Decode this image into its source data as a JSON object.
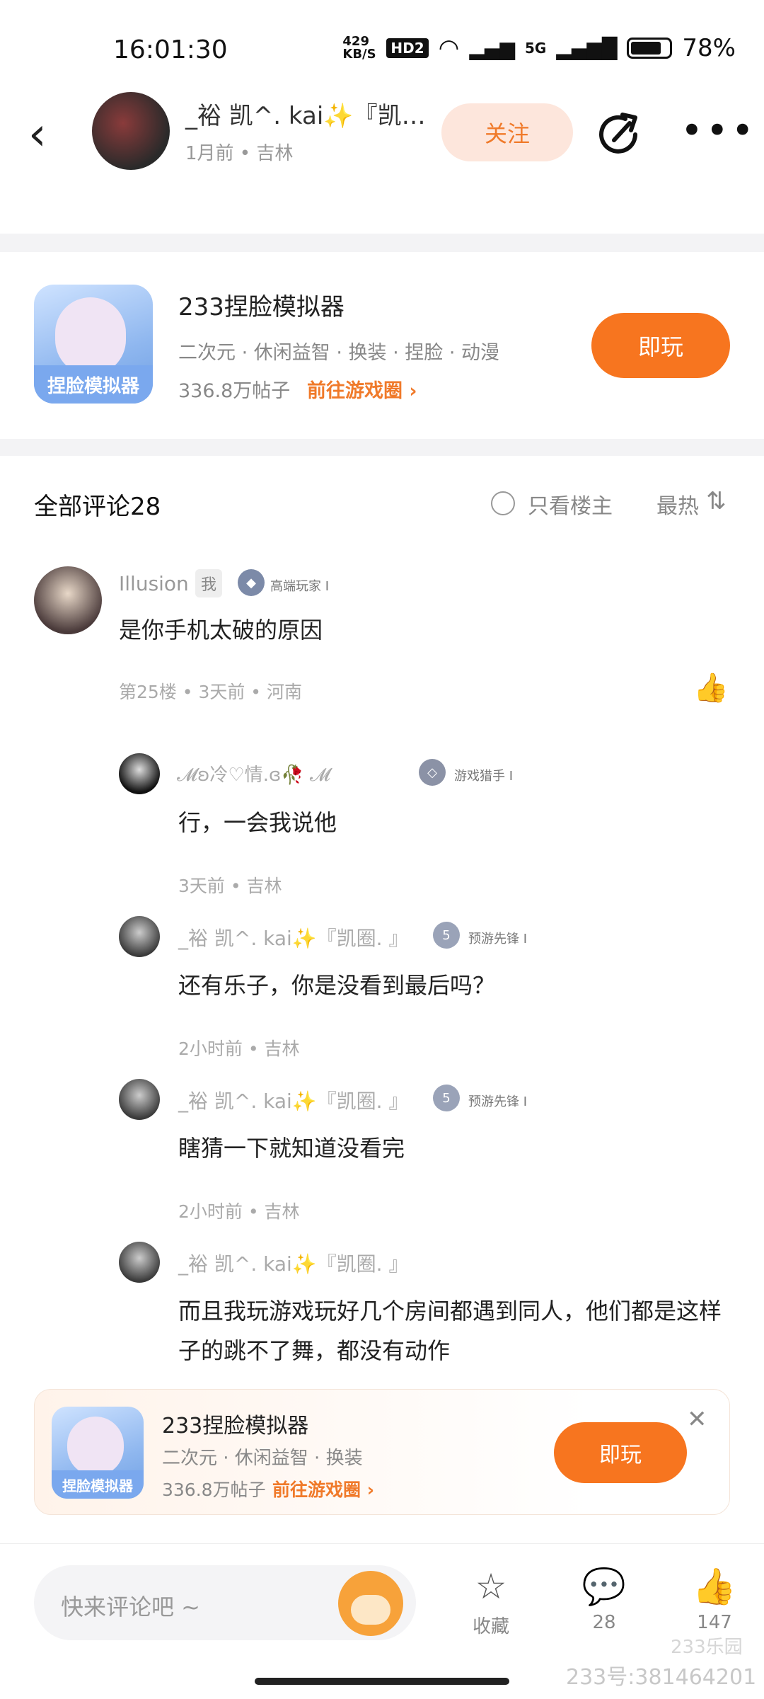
{
  "status_bar": {
    "time": "16:01:30",
    "net_speed": "429 KB/S",
    "hd": "HD2",
    "signal": "5G",
    "battery": "78%"
  },
  "header": {
    "author_name": "_裕 凯^. kai✨『凯…",
    "author_meta": "1月前 • 吉林",
    "follow_label": "关注"
  },
  "game_card": {
    "title": "233捏脸模拟器",
    "tags": "二次元 · 休闲益智 · 换装 · 捏脸 · 动漫",
    "posts": "336.8万帖子",
    "link_label": "前往游戏圈",
    "play_label": "即玩",
    "icon_text": "捏脸模拟器"
  },
  "comments_header": {
    "title": "全部评论28",
    "only_author": "只看楼主",
    "sort_label": "最热"
  },
  "comments": [
    {
      "name": "Illusion",
      "me_badge": "我",
      "level": "高端玩家 I",
      "text": "是你手机太破的原因",
      "meta": "第25楼 • 3天前 • 河南"
    }
  ],
  "replies": [
    {
      "name": "𝓜ʚ冷♡情.ɞ🥀 𝓜",
      "level": "游戏猎手 I",
      "text": "行，一会我说他",
      "meta": "3天前 • 吉林"
    },
    {
      "name": "_裕 凯^. kai✨『凯圈. 』",
      "level": "预游先锋 I",
      "text": "还有乐子，你是没看到最后吗？",
      "meta": "2小时前 • 吉林"
    },
    {
      "name": "_裕 凯^. kai✨『凯圈. 』",
      "level": "预游先锋 I",
      "text": "瞎猜一下就知道没看完",
      "meta": "2小时前 • 吉林"
    },
    {
      "name": "_裕 凯^. kai✨『凯圈. 』",
      "text": "而且我玩游戏玩好几个房间都遇到同人，他们都是这样子的跳不了舞，都没有动作"
    }
  ],
  "floating_card": {
    "title": "233捏脸模拟器",
    "tags": "二次元 · 休闲益智 · 换装",
    "posts": "336.8万帖子",
    "link_label": "前往游戏圈",
    "play_label": "即玩"
  },
  "bottom_bar": {
    "input_placeholder": "快来评论吧 ~",
    "collect_label": "收藏",
    "comment_count": "28",
    "like_count": "147"
  },
  "watermark": {
    "text": "233号:381464201",
    "logo": "233乐园"
  },
  "colors": {
    "accent": "#f7751f",
    "follow_bg": "#fde6dc"
  }
}
